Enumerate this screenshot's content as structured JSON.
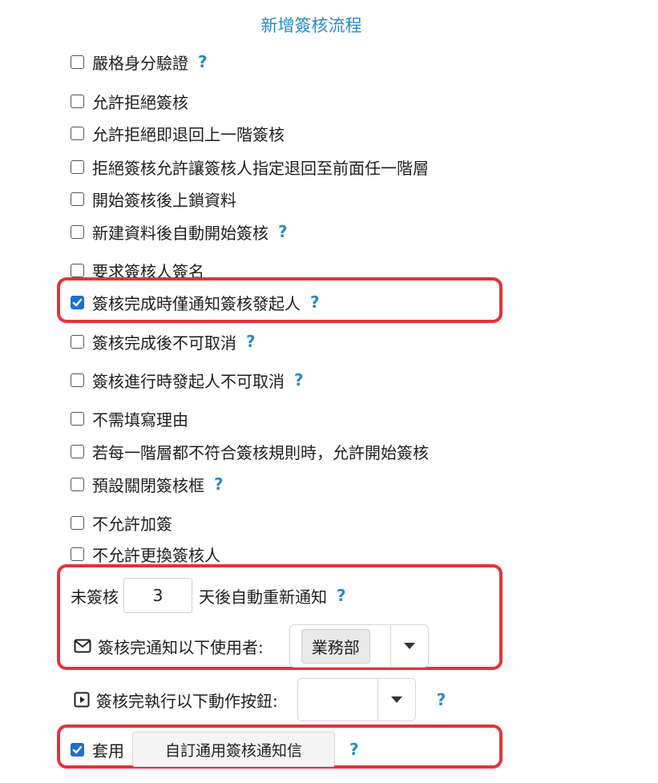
{
  "title": "新增簽核流程",
  "options": [
    {
      "label": "嚴格身分驗證",
      "checked": false,
      "help": "?"
    },
    {
      "label": "允許拒絕簽核",
      "checked": false
    },
    {
      "label": "允許拒絕即退回上一階簽核",
      "checked": false
    },
    {
      "label": "拒絕簽核允許讓簽核人指定退回至前面任一階層",
      "checked": false
    },
    {
      "label": "開始簽核後上鎖資料",
      "checked": false
    },
    {
      "label": "新建資料後自動開始簽核",
      "checked": false,
      "help": "?"
    },
    {
      "label": "要求簽核人簽名",
      "checked": false
    },
    {
      "label": "簽核完成時僅通知簽核發起人",
      "checked": true,
      "help": "?"
    },
    {
      "label": "簽核完成後不可取消",
      "checked": false,
      "help": "?"
    },
    {
      "label": "簽核進行時發起人不可取消",
      "checked": false,
      "help": "?"
    },
    {
      "label": "不需填寫理由",
      "checked": false
    },
    {
      "label": "若每一階層都不符合簽核規則時，允許開始簽核",
      "checked": false
    },
    {
      "label": "預設關閉簽核框",
      "checked": false,
      "help": "?"
    },
    {
      "label": "不允許加簽",
      "checked": false
    },
    {
      "label": "不允許更換簽核人",
      "checked": false
    }
  ],
  "renotify": {
    "prefix": "未簽核",
    "days": "3",
    "suffix": "天後自動重新通知",
    "help": "?"
  },
  "notify_users": {
    "label": "簽核完通知以下使用者:",
    "selected": "業務部",
    "icon": "mail-icon"
  },
  "action_button": {
    "label": "簽核完執行以下動作按鈕:",
    "selected": "",
    "help": "?",
    "icon": "play-box-icon"
  },
  "apply": {
    "label": "套用",
    "checked": true,
    "button": "自訂通用簽核通知信",
    "help": "?"
  },
  "colors": {
    "accent": "#2a8acb",
    "highlight": "#e8313b",
    "checkbox_checked": "#1f6fd1"
  }
}
